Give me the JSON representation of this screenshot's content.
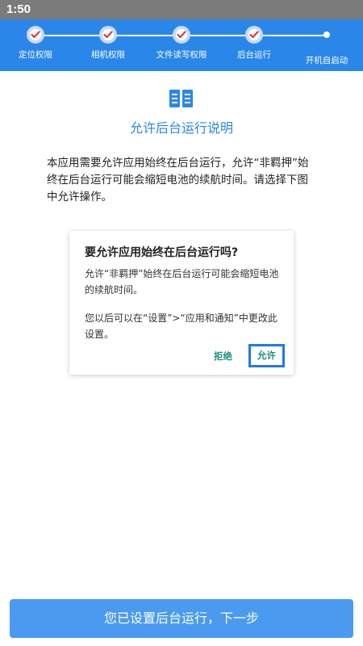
{
  "status_bar": {
    "time": "1:50"
  },
  "steps": [
    {
      "label": "定位权限",
      "state": "done"
    },
    {
      "label": "相机权限",
      "state": "done"
    },
    {
      "label": "文件读写权限",
      "state": "done"
    },
    {
      "label": "后台运行",
      "state": "done"
    },
    {
      "label": "开机自启动",
      "state": "pending"
    }
  ],
  "colors": {
    "primary": "#2b86ea",
    "check": "#e53935",
    "dialog_button": "#1e8f80",
    "highlight": "#1e7be0",
    "button": "#4a9af0"
  },
  "page": {
    "icon": "book-icon",
    "title": "允许后台运行说明",
    "description": "本应用需要允许应用始终在后台运行，允许“非羁押”始终在后台运行可能会缩短电池的续航时间。请选择下图中允许操作。"
  },
  "dialog": {
    "title": "要允许应用始终在后台运行吗?",
    "body1": "允许“非羁押”始终在后台运行可能会缩短电池的续航时间。",
    "body2": "您以后可以在“设置”>“应用和通知”中更改此设置。",
    "deny": "拒绝",
    "allow": "允许"
  },
  "next_button": "您已设置后台运行，下一步"
}
